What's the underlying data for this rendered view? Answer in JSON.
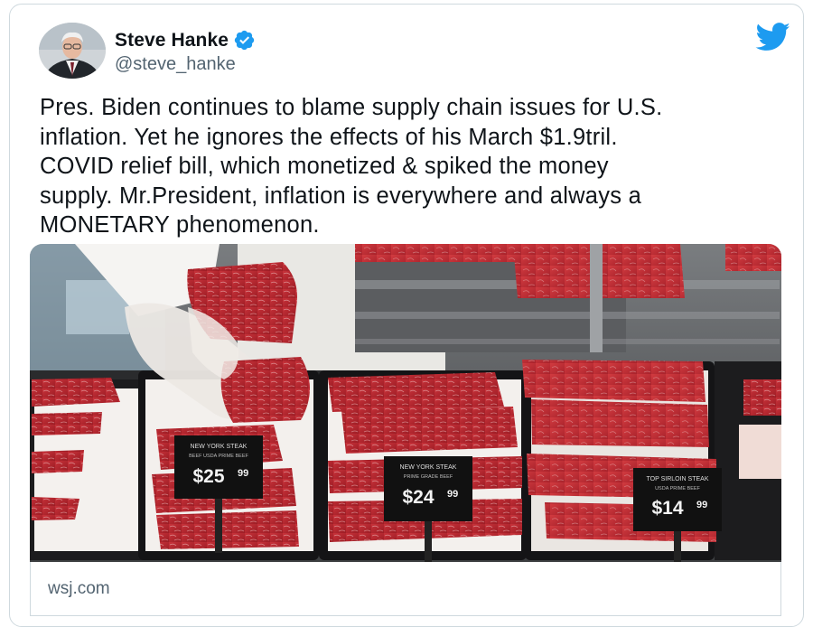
{
  "author": {
    "display_name": "Steve Hanke",
    "handle": "@steve_hanke",
    "verified": true,
    "avatar_icon": "profile-photo"
  },
  "platform_icon": "twitter-bird-icon",
  "tweet": {
    "text": "Pres. Biden continues to blame supply chain issues for U.S.\ninflation.  Yet he ignores the effects of his March $1.9tril.\nCOVID relief bill, which monetized & spiked the money\nsupply. Mr.President, inflation is everywhere and always a\nMONETARY phenomenon."
  },
  "media": {
    "description_icon": "meat-display-photo",
    "price_tags": [
      {
        "title": "NEW YORK STEAK",
        "sub": "BEEF USDA PRIME BEEF",
        "price": "$25",
        "cents": "99"
      },
      {
        "title": "NEW YORK STEAK",
        "sub": "PRIME GRADE BEEF",
        "price": "$24",
        "cents": "99"
      },
      {
        "title": "TOP SIRLOIN STEAK",
        "sub": "USDA PRIME BEEF",
        "price": "$14",
        "cents": "99"
      }
    ]
  },
  "link_card": {
    "domain": "wsj.com"
  },
  "colors": {
    "accent": "#1d9bf0",
    "text": "#0f1419",
    "muted": "#536471",
    "border": "#cfd9de"
  }
}
